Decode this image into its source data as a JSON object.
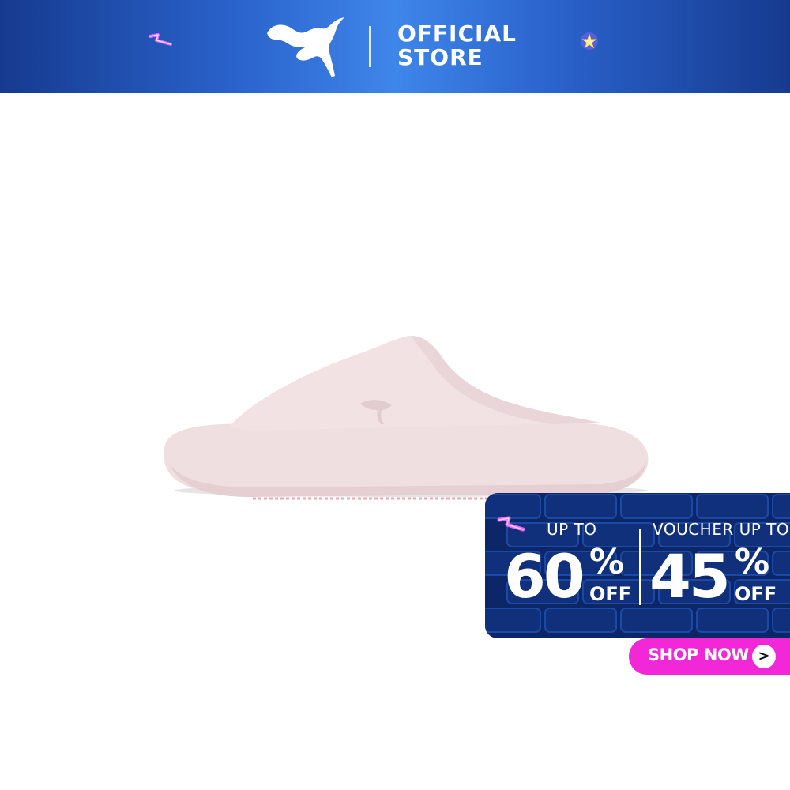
{
  "banner": {
    "brand_logo": "puma-cat-icon",
    "store_line1": "OFFICIAL",
    "store_line2": "STORE",
    "background_colors": [
      "#163a8f",
      "#3f86ea"
    ]
  },
  "product": {
    "image": "pink-slide-sandal"
  },
  "promo": {
    "left_label": "UP TO",
    "left_value": "60",
    "left_percent": "%",
    "left_off": "OFF",
    "right_label": "VOUCHER UP TO",
    "right_value": "45",
    "right_percent": "%",
    "right_off": "OFF",
    "background_color": "#0d2668"
  },
  "cta": {
    "label": "SHOP NOW",
    "arrow": ">",
    "color": "#f228d8"
  }
}
